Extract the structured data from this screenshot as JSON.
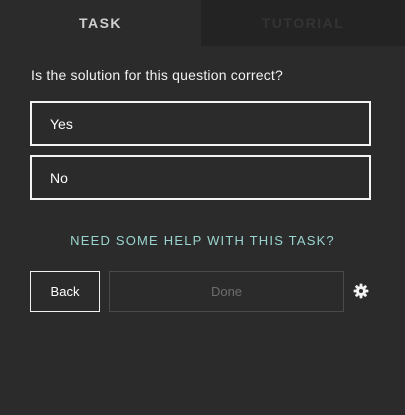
{
  "tabs": [
    {
      "label": "TASK",
      "active": true
    },
    {
      "label": "TUTORIAL",
      "active": false
    }
  ],
  "question": "Is the solution for this question correct?",
  "options": [
    {
      "label": "Yes"
    },
    {
      "label": "No"
    }
  ],
  "help_link": "NEED SOME HELP WITH THIS TASK?",
  "buttons": {
    "back": "Back",
    "done": "Done"
  },
  "icons": {
    "settings": "gear-icon"
  },
  "colors": {
    "background": "#2b2b2b",
    "inactive_tab": "#232323",
    "help_link": "#9ad4d0",
    "disabled_text": "#6d6d6d"
  }
}
